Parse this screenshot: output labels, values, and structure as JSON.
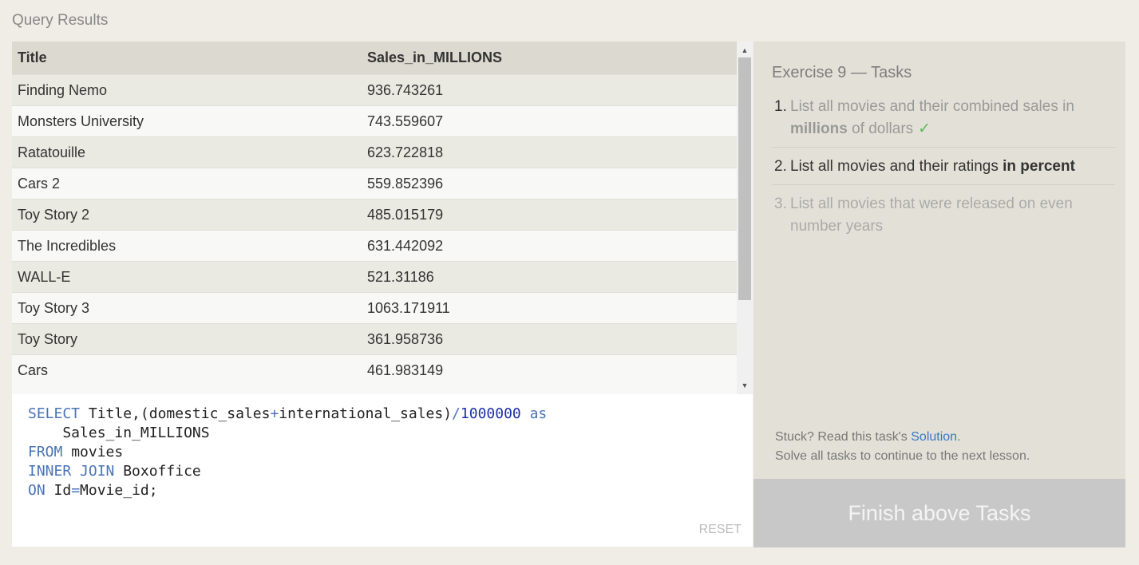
{
  "section_title": "Query Results",
  "table": {
    "headers": [
      "Title",
      "Sales_in_MILLIONS"
    ],
    "rows": [
      [
        "Finding Nemo",
        "936.743261"
      ],
      [
        "Monsters University",
        "743.559607"
      ],
      [
        "Ratatouille",
        "623.722818"
      ],
      [
        "Cars 2",
        "559.852396"
      ],
      [
        "Toy Story 2",
        "485.015179"
      ],
      [
        "The Incredibles",
        "631.442092"
      ],
      [
        "WALL-E",
        "521.31186"
      ],
      [
        "Toy Story 3",
        "1063.171911"
      ],
      [
        "Toy Story",
        "361.958736"
      ],
      [
        "Cars",
        "461.983149"
      ]
    ]
  },
  "scrollbar": {
    "up_icon": "triangle-up",
    "down_icon": "triangle-down",
    "up_glyph": "▲",
    "down_glyph": "▼"
  },
  "editor": {
    "line1": {
      "kw1": "SELECT",
      "text1": " Title,(domestic_sales",
      "op1": "+",
      "text2": "international_sales)",
      "op2": "/",
      "num": "1000000",
      "sp": " ",
      "kw2": "as"
    },
    "line2": "    Sales_in_MILLIONS",
    "line3": {
      "kw": "FROM",
      "text": " movies"
    },
    "line4": {
      "kw": "INNER JOIN",
      "text": " Boxoffice"
    },
    "line5": {
      "kw": "ON",
      "text1": " Id",
      "op": "=",
      "text2": "Movie_id;"
    },
    "reset_label": "RESET"
  },
  "tasks": {
    "title": "Exercise 9 — Tasks",
    "items": [
      {
        "number": "1.",
        "text_a": "List all movies and their combined sales in ",
        "bold": "millions",
        "text_b": " of dollars",
        "check": "✓"
      },
      {
        "number": "2.",
        "text_a": "List all movies and their ratings ",
        "bold": "in percent"
      },
      {
        "number": "3.",
        "text_a": "List all movies that were released on even number years"
      }
    ],
    "stuck_prefix": "Stuck? Read this task's ",
    "solution_link": "Solution",
    "stuck_suffix": ".",
    "stuck_line2": "Solve all tasks to continue to the next lesson."
  },
  "finish_button_label": "Finish above Tasks",
  "colors": {
    "page_bg": "#f0ede6",
    "header_bg": "#dcdad0",
    "tasks_bg": "#e3e1d7",
    "keyword": "#4a74b6",
    "number": "#1e30a8",
    "link": "#3a78c2",
    "check": "#5cb85c",
    "finish_bg": "#c8c8c8"
  }
}
